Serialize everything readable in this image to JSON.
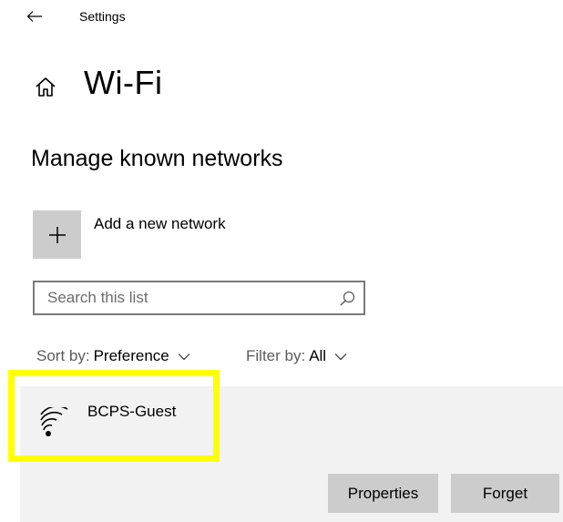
{
  "window": {
    "title": "Settings"
  },
  "page": {
    "title": "Wi-Fi",
    "section_title": "Manage known networks"
  },
  "add_network": {
    "label": "Add a new network",
    "icon": "plus-icon"
  },
  "search": {
    "placeholder": "Search this list",
    "value": ""
  },
  "sort": {
    "prefix": "Sort by:",
    "value": "Preference"
  },
  "filter": {
    "prefix": "Filter by:",
    "value": "All"
  },
  "networks": [
    {
      "name": "BCPS-Guest",
      "icon": "wifi-signal-icon",
      "actions": {
        "properties_label": "Properties",
        "forget_label": "Forget"
      }
    }
  ],
  "colors": {
    "highlight": "#ffff00",
    "item_background": "#f2f2f2",
    "button_background": "#cccccc",
    "search_border": "#7a7a7a"
  }
}
